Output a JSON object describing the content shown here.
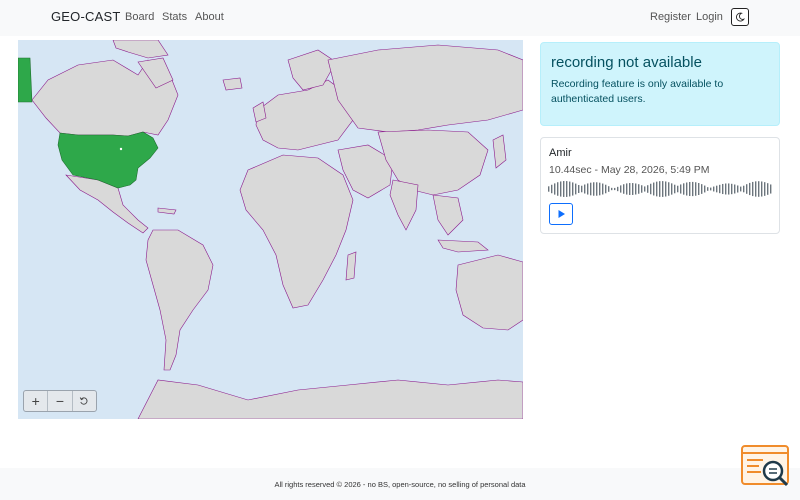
{
  "navbar": {
    "brand": "GEO-CAST",
    "links": [
      "Board",
      "Stats",
      "About"
    ],
    "register_label": "Register",
    "login_label": "Login",
    "theme_icon": "moon-icon"
  },
  "map": {
    "highlighted_countries": [
      "United States",
      "Greenland"
    ],
    "highlight_color": "#2ea84a",
    "land_color": "#d9d9d9",
    "border_color": "#8b1a8b",
    "ocean_color": "#d6e6f4",
    "controls": {
      "zoom_in": "+",
      "zoom_out": "−",
      "reset_icon": "reset-icon"
    }
  },
  "alert": {
    "title": "recording not available",
    "text": "Recording feature is only available to authenticated users."
  },
  "recording": {
    "name": "Amir",
    "meta": "10.44sec - May 28, 2026, 5:49 PM",
    "play_icon": "play-icon"
  },
  "footer": {
    "text": "All rights reserved © 2026 - no BS, open-source, no selling of personal data"
  }
}
